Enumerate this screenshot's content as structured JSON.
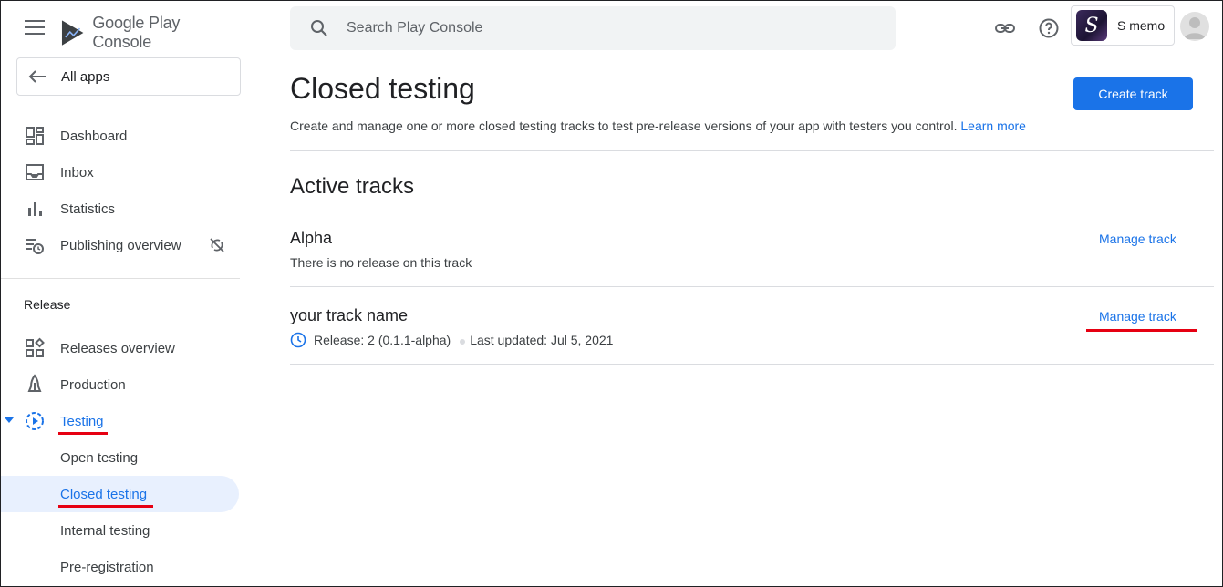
{
  "header": {
    "app_title": "Google Play Console",
    "search_placeholder": "Search Play Console",
    "app_name": "S memo",
    "app_icon_letter": "S"
  },
  "sidebar": {
    "all_apps": "All apps",
    "items": [
      {
        "label": "Dashboard",
        "icon": "dashboard-icon"
      },
      {
        "label": "Inbox",
        "icon": "inbox-icon"
      },
      {
        "label": "Statistics",
        "icon": "bar-chart-icon"
      },
      {
        "label": "Publishing overview",
        "icon": "publishing-overview-icon"
      }
    ],
    "release_section": "Release",
    "release_items": [
      {
        "label": "Releases overview",
        "icon": "releases-overview-icon"
      },
      {
        "label": "Production",
        "icon": "production-icon"
      },
      {
        "label": "Testing",
        "icon": "testing-icon",
        "expanded": true
      }
    ],
    "testing_sub": [
      {
        "label": "Open testing"
      },
      {
        "label": "Closed testing",
        "active": true
      },
      {
        "label": "Internal testing"
      },
      {
        "label": "Pre-registration"
      }
    ]
  },
  "main": {
    "title": "Closed testing",
    "create_button": "Create track",
    "description": "Create and manage one or more closed testing tracks to test pre-release versions of your app with testers you control.",
    "learn_more": "Learn more",
    "section_title": "Active tracks",
    "tracks": [
      {
        "name": "Alpha",
        "status": "There is no release on this track",
        "action": "Manage track"
      },
      {
        "name": "your track name",
        "release": "Release: 2 (0.1.1-alpha)",
        "updated": "Last updated: Jul 5, 2021",
        "action": "Manage track"
      }
    ]
  },
  "colors": {
    "accent": "#1a73e8",
    "annotation_red": "#e60012",
    "active_bg": "#e8f0fe"
  }
}
